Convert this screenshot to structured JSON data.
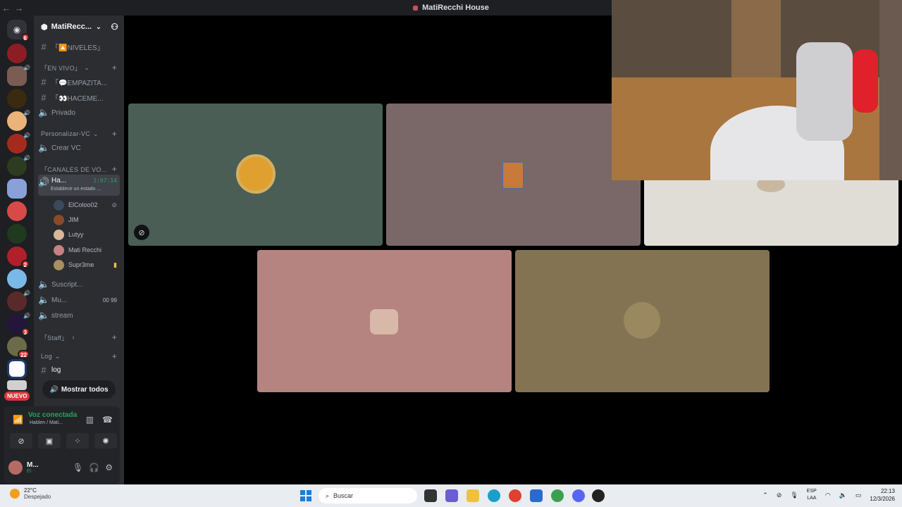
{
  "window": {
    "title": "MatiRecchi House",
    "back": "←",
    "forward": "→"
  },
  "server": {
    "name": "MatiRecc..."
  },
  "channels": {
    "niveles": "「🔼NIVELES」",
    "cat_envivo": "「EN VIVO」",
    "empazitando": "「💬EMPAZITA...",
    "haceme": "「👀HACEME...",
    "privado": "Privado",
    "cat_personalizar": "Personalizar-VC",
    "crear_vc": "Crear VC",
    "cat_canales": "「CANALES DE VO...",
    "active_vc": "Ha...",
    "active_timer": "1:07:14",
    "active_status": "Establece un estado ...",
    "suscript": "Suscript...",
    "mu": "Mu...",
    "mu_counts": "00 99",
    "stream": "stream",
    "cat_staff": "「Staff」",
    "cat_log": "Log",
    "log": "log",
    "show_all": "Mostrar todos"
  },
  "members": [
    {
      "name": "ElColoo02"
    },
    {
      "name": "JIM"
    },
    {
      "name": "Lutyy"
    },
    {
      "name": "Mati Recchi"
    },
    {
      "name": "Supr3me"
    }
  ],
  "guild_badges": {
    "g1": "6",
    "g12": "2",
    "g15": "3",
    "g16": "22",
    "new": "NUEVO"
  },
  "voice": {
    "status": "Voz conectada",
    "sub": "Hablen / Mati...",
    "user": "M...",
    "user_sub": "El"
  },
  "taskbar": {
    "temp": "22°C",
    "condition": "Despejado",
    "search": "Buscar",
    "lang1": "ESP",
    "lang2": "LAA",
    "time": "22:13",
    "date": "12/3/2026"
  },
  "colors": {
    "accent_green": "#23a55a",
    "danger": "#da373c"
  }
}
